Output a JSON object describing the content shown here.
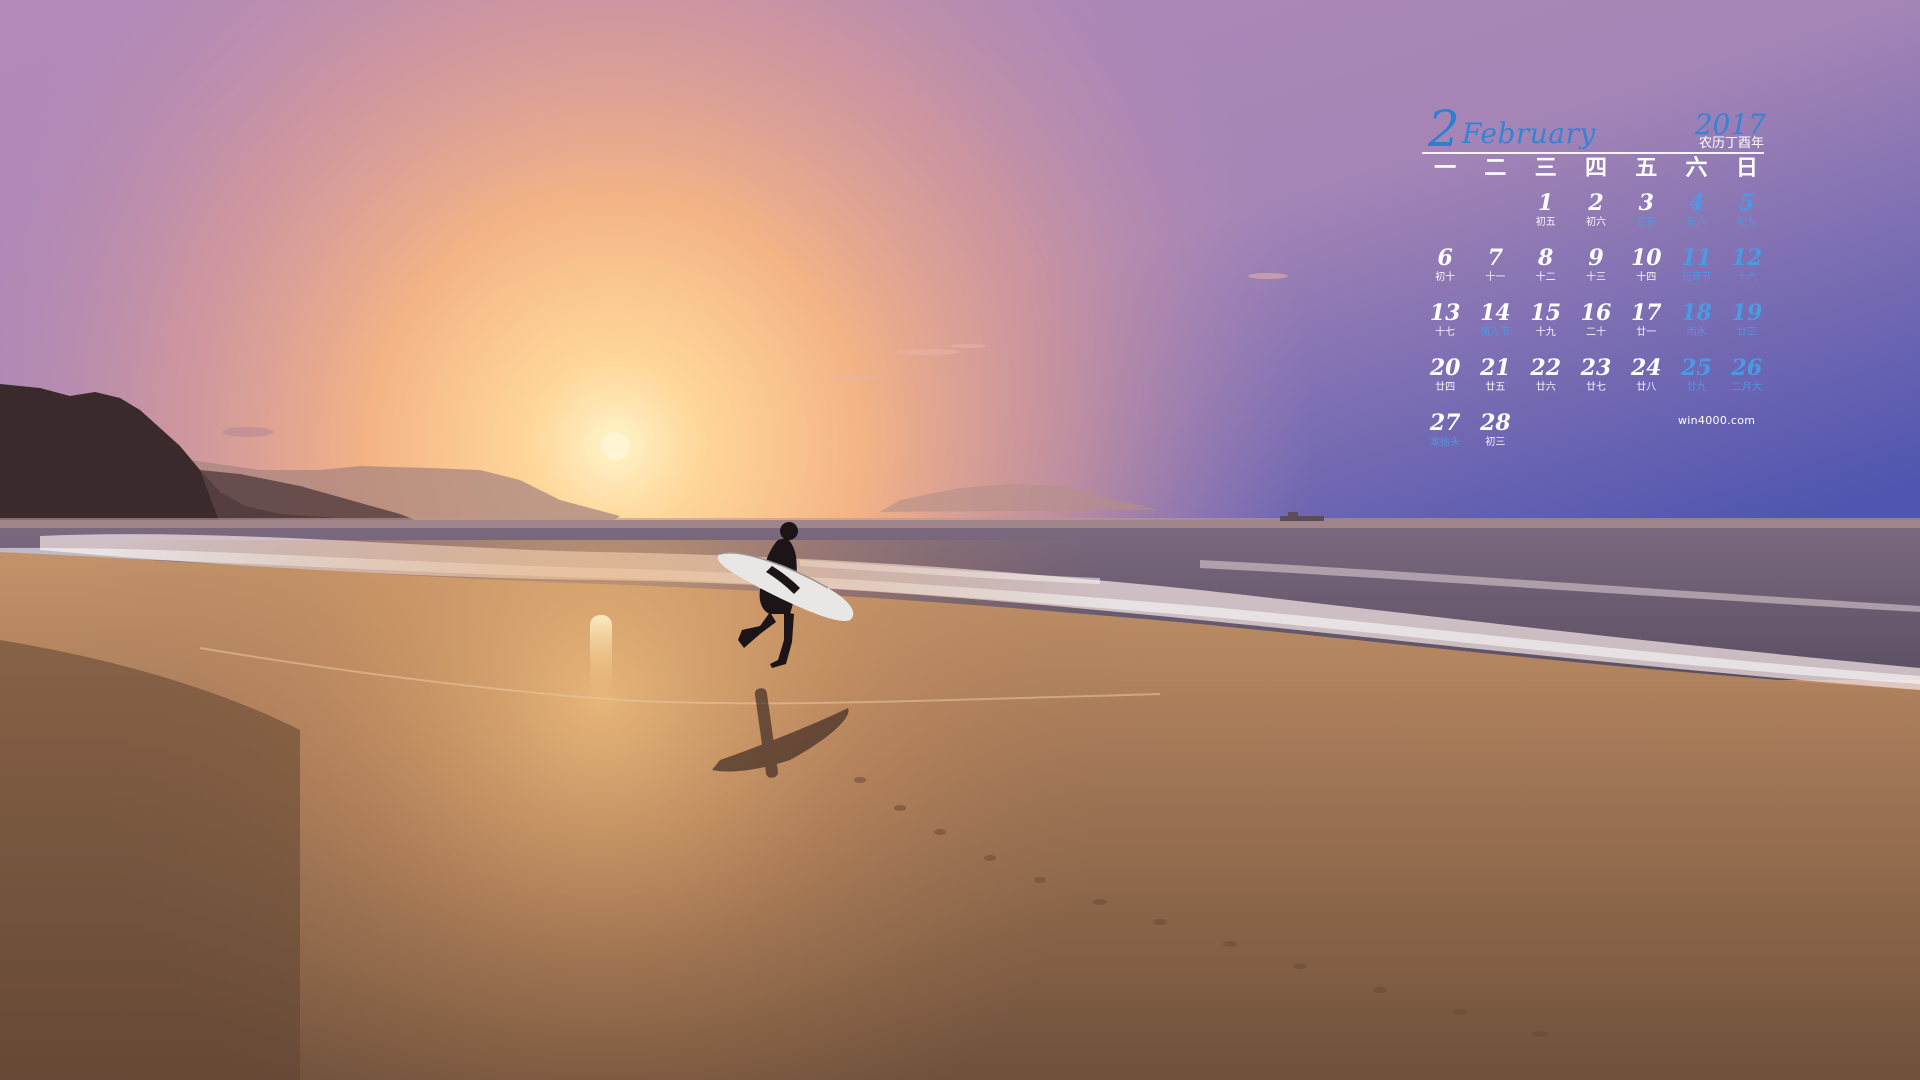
{
  "calendar": {
    "month_number": "2",
    "month_name": "February",
    "year": "2017",
    "lunar_year": "农历丁酉年",
    "weekdays": [
      "一",
      "二",
      "三",
      "四",
      "五",
      "六",
      "日"
    ],
    "site": "win4000.com",
    "weeks": [
      [
        {
          "day": "",
          "lunar": ""
        },
        {
          "day": "",
          "lunar": ""
        },
        {
          "day": "1",
          "lunar": "初五"
        },
        {
          "day": "2",
          "lunar": "初六"
        },
        {
          "day": "3",
          "lunar": "立春"
        },
        {
          "day": "4",
          "lunar": "初八"
        },
        {
          "day": "5",
          "lunar": "初九"
        }
      ],
      [
        {
          "day": "6",
          "lunar": "初十"
        },
        {
          "day": "7",
          "lunar": "十一"
        },
        {
          "day": "8",
          "lunar": "十二"
        },
        {
          "day": "9",
          "lunar": "十三"
        },
        {
          "day": "10",
          "lunar": "十四"
        },
        {
          "day": "11",
          "lunar": "元宵节"
        },
        {
          "day": "12",
          "lunar": "十六"
        }
      ],
      [
        {
          "day": "13",
          "lunar": "十七"
        },
        {
          "day": "14",
          "lunar": "情人节"
        },
        {
          "day": "15",
          "lunar": "十九"
        },
        {
          "day": "16",
          "lunar": "二十"
        },
        {
          "day": "17",
          "lunar": "廿一"
        },
        {
          "day": "18",
          "lunar": "雨水"
        },
        {
          "day": "19",
          "lunar": "廿三"
        }
      ],
      [
        {
          "day": "20",
          "lunar": "廿四"
        },
        {
          "day": "21",
          "lunar": "廿五"
        },
        {
          "day": "22",
          "lunar": "廿六"
        },
        {
          "day": "23",
          "lunar": "廿七"
        },
        {
          "day": "24",
          "lunar": "廿八"
        },
        {
          "day": "25",
          "lunar": "廿九"
        },
        {
          "day": "26",
          "lunar": "二月大"
        }
      ],
      [
        {
          "day": "27",
          "lunar": "龙抬头"
        },
        {
          "day": "28",
          "lunar": "初三"
        },
        {
          "day": "",
          "lunar": ""
        },
        {
          "day": "",
          "lunar": ""
        },
        {
          "day": "",
          "lunar": ""
        },
        {
          "day": "",
          "lunar": ""
        },
        {
          "day": "",
          "lunar": ""
        }
      ]
    ]
  },
  "colors": {
    "sky_top": "#8a6fc0",
    "sky_horizon": "#f0b27a",
    "sun": "#fff6d0",
    "sand": "#8a6548",
    "accent_blue": "#3384d6"
  }
}
